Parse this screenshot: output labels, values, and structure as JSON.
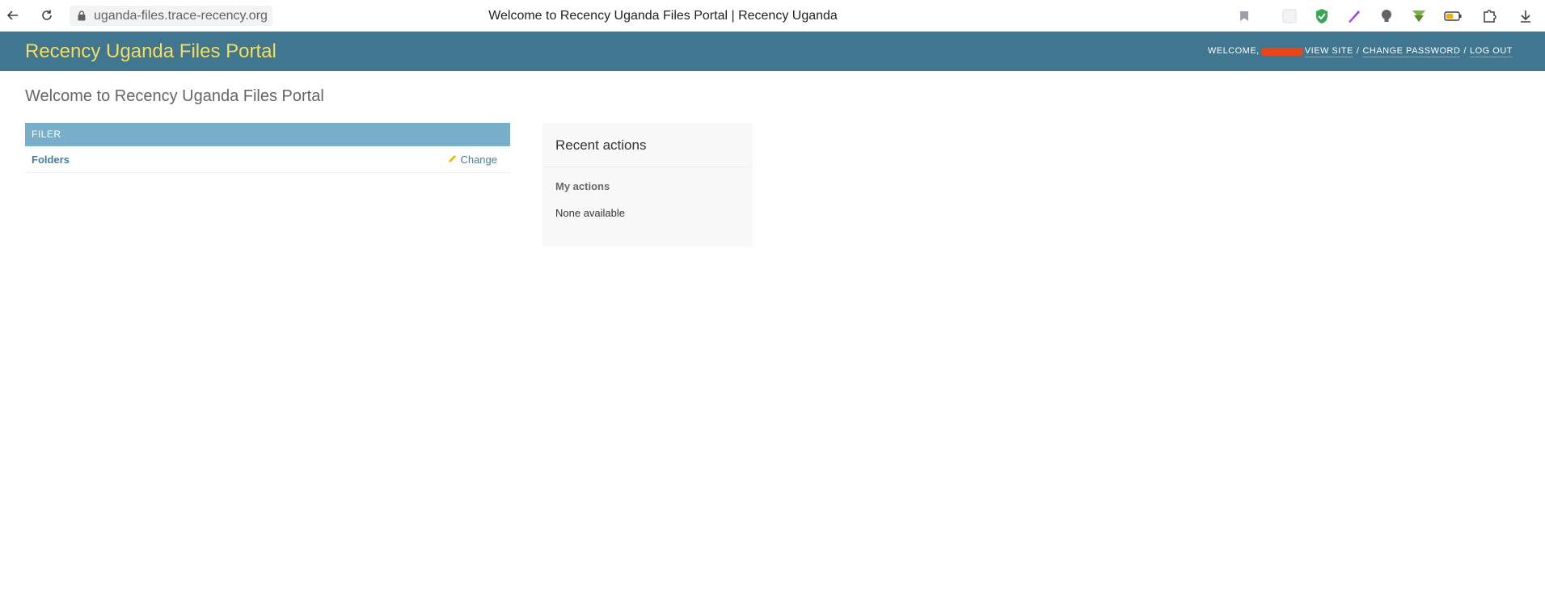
{
  "browser": {
    "url": "uganda-files.trace-recency.org",
    "tab_title": "Welcome to Recency Uganda Files Portal | Recency Uganda"
  },
  "header": {
    "branding": "Recency Uganda Files Portal",
    "welcome": "Welcome,",
    "view_site": "View site",
    "change_password": "Change password",
    "log_out": "Log out",
    "separator": "/"
  },
  "content": {
    "title": "Welcome to Recency Uganda Files Portal",
    "app_module": {
      "caption": "Filer",
      "rows": [
        {
          "label": "Folders",
          "action": "Change"
        }
      ]
    },
    "recent_actions": {
      "title": "Recent actions",
      "subtitle": "My actions",
      "empty_text": "None available"
    }
  },
  "colors": {
    "header_bg": "#417690",
    "branding": "#f5dd5d",
    "module_caption_bg": "#79aec8",
    "link": "#447e9b"
  }
}
